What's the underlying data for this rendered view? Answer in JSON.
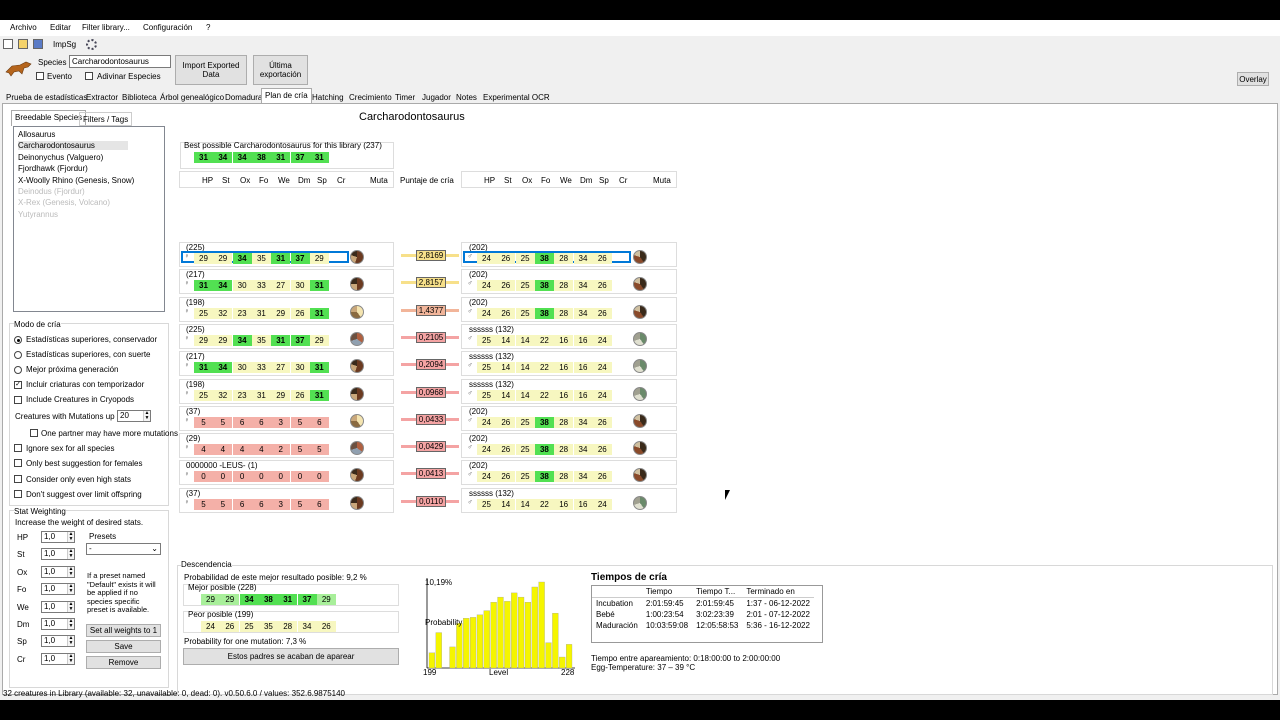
{
  "menu": [
    "Archivo",
    "Editar",
    "Filter library...",
    "Configuración",
    "?"
  ],
  "toolbar": {
    "impsg": "ImpSg"
  },
  "species": {
    "label": "Species",
    "value": "Carcharodontosaurus",
    "evento": "Evento",
    "adivinar": "Adivinar Especies"
  },
  "buttons": {
    "import": "Import Exported Data",
    "ultima": "Última exportación",
    "overlay": "Overlay"
  },
  "tabs": [
    "Prueba de estadísticas",
    "Extractor",
    "Biblioteca",
    "Árbol genealógico",
    "Domadura",
    "Plan de cría",
    "Hatching",
    "Crecimiento",
    "Timer",
    "Jugador",
    "Notes",
    "Experimental OCR"
  ],
  "left": {
    "tab_breedable": "Breedable Species",
    "tab_filters": "Filters / Tags",
    "species_list": [
      {
        "name": "Allosaurus",
        "enabled": true
      },
      {
        "name": "Carcharodontosaurus",
        "enabled": true
      },
      {
        "name": "Deinonychus (Valguero)",
        "enabled": true
      },
      {
        "name": "Fjordhawk (Fjordur)",
        "enabled": true
      },
      {
        "name": "X-Woolly Rhino (Genesis, Snow)",
        "enabled": true
      },
      {
        "name": "Deinodus (Fjordur)",
        "enabled": false
      },
      {
        "name": "X-Rex (Genesis, Volcano)",
        "enabled": false
      },
      {
        "name": "Yutyrannus",
        "enabled": false
      }
    ],
    "mode_title": "Modo de cría",
    "modes": [
      "Estadísticas superiores, conservador",
      "Estadísticas superiores, con suerte",
      "Mejor próxima generación"
    ],
    "opt_timer": "Incluir criaturas con temporizador",
    "opt_cryo": "Include Creatures in Cryopods",
    "mut_label": "Creatures with Mutations up to",
    "mut_value": "20",
    "one_partner": "One partner may have more mutations",
    "ignore_sex": "Ignore sex for all species",
    "only_best_f": "Only best suggestion for females",
    "even_high": "Consider only even high stats",
    "dont_suggest": "Don't suggest over limit offspring",
    "weight_title": "Stat Weighting",
    "weight_desc": "Increase the weight of desired stats.",
    "weights": [
      {
        "stat": "HP",
        "value": "1,0"
      },
      {
        "stat": "St",
        "value": "1,0"
      },
      {
        "stat": "Ox",
        "value": "1,0"
      },
      {
        "stat": "Fo",
        "value": "1,0"
      },
      {
        "stat": "We",
        "value": "1,0"
      },
      {
        "stat": "Dm",
        "value": "1,0"
      },
      {
        "stat": "Sp",
        "value": "1,0"
      },
      {
        "stat": "Cr",
        "value": "1,0"
      }
    ],
    "presets_label": "Presets",
    "presets_value": "-",
    "preset_note": "If a preset named \"Default\" exists it will be applied if no species specific preset is available.",
    "set_all": "Set all weights to 1",
    "save": "Save",
    "remove": "Remove"
  },
  "main": {
    "title": "Carcharodontosaurus",
    "best_label": "Best possible Carcharodontosaurus for this library (237)",
    "best_values": [
      "31",
      "34",
      "34",
      "38",
      "31",
      "37",
      "31"
    ],
    "stat_headers": [
      "HP",
      "St",
      "Ox",
      "Fo",
      "We",
      "Dm",
      "Sp",
      "Cr",
      "Muta"
    ],
    "score_header": "Puntaje de cría",
    "pairs": [
      {
        "lname": "(225)",
        "lsex": "♀",
        "lv": [
          "29",
          "29",
          "34",
          "35",
          "31",
          "37",
          "29"
        ],
        "lc": [
          "y",
          "y",
          "g",
          "y",
          "g",
          "g",
          "y"
        ],
        "score": "2,8169",
        "sc": "#f7e08a",
        "rname": "(202)",
        "rsex": "♂",
        "rv": [
          "24",
          "26",
          "25",
          "38",
          "28",
          "34",
          "26"
        ],
        "rc": [
          "y",
          "y",
          "y",
          "g",
          "y",
          "y",
          "y"
        ],
        "sel": true
      },
      {
        "lname": "(217)",
        "lsex": "♀",
        "lv": [
          "31",
          "34",
          "30",
          "33",
          "27",
          "30",
          "31"
        ],
        "lc": [
          "g",
          "g",
          "y",
          "y",
          "y",
          "y",
          "g"
        ],
        "score": "2,8157",
        "sc": "#f7e08a",
        "rname": "(202)",
        "rsex": "♂",
        "rv": [
          "24",
          "26",
          "25",
          "38",
          "28",
          "34",
          "26"
        ],
        "rc": [
          "y",
          "y",
          "y",
          "g",
          "y",
          "y",
          "y"
        ]
      },
      {
        "lname": "(198)",
        "lsex": "♀",
        "lv": [
          "25",
          "32",
          "23",
          "31",
          "29",
          "26",
          "31"
        ],
        "lc": [
          "y",
          "y",
          "y",
          "y",
          "y",
          "y",
          "g"
        ],
        "score": "1,4377",
        "sc": "#f2b59a",
        "rname": "(202)",
        "rsex": "♂",
        "rv": [
          "24",
          "26",
          "25",
          "38",
          "28",
          "34",
          "26"
        ],
        "rc": [
          "y",
          "y",
          "y",
          "g",
          "y",
          "y",
          "y"
        ]
      },
      {
        "lname": "(225)",
        "lsex": "♀",
        "lv": [
          "29",
          "29",
          "34",
          "35",
          "31",
          "37",
          "29"
        ],
        "lc": [
          "y",
          "y",
          "g",
          "y",
          "g",
          "g",
          "y"
        ],
        "score": "0,2105",
        "sc": "#f4a3a3",
        "rname": "ssssss (132)",
        "rsex": "♂",
        "rv": [
          "25",
          "14",
          "14",
          "22",
          "16",
          "16",
          "24"
        ],
        "rc": [
          "y",
          "y",
          "y",
          "y",
          "y",
          "y",
          "y"
        ]
      },
      {
        "lname": "(217)",
        "lsex": "♀",
        "lv": [
          "31",
          "34",
          "30",
          "33",
          "27",
          "30",
          "31"
        ],
        "lc": [
          "g",
          "g",
          "y",
          "y",
          "y",
          "y",
          "g"
        ],
        "score": "0,2094",
        "sc": "#f4a3a3",
        "rname": "ssssss (132)",
        "rsex": "♂",
        "rv": [
          "25",
          "14",
          "14",
          "22",
          "16",
          "16",
          "24"
        ],
        "rc": [
          "y",
          "y",
          "y",
          "y",
          "y",
          "y",
          "y"
        ]
      },
      {
        "lname": "(198)",
        "lsex": "♀",
        "lv": [
          "25",
          "32",
          "23",
          "31",
          "29",
          "26",
          "31"
        ],
        "lc": [
          "y",
          "y",
          "y",
          "y",
          "y",
          "y",
          "g"
        ],
        "score": "0,0968",
        "sc": "#f4a3a3",
        "rname": "ssssss (132)",
        "rsex": "♂",
        "rv": [
          "25",
          "14",
          "14",
          "22",
          "16",
          "16",
          "24"
        ],
        "rc": [
          "y",
          "y",
          "y",
          "y",
          "y",
          "y",
          "y"
        ]
      },
      {
        "lname": "(37)",
        "lsex": "♀",
        "lv": [
          "5",
          "5",
          "6",
          "6",
          "3",
          "5",
          "6"
        ],
        "lc": [
          "r",
          "r",
          "r",
          "r",
          "r",
          "r",
          "r"
        ],
        "score": "0,0433",
        "sc": "#f4a3a3",
        "rname": "(202)",
        "rsex": "♂",
        "rv": [
          "24",
          "26",
          "25",
          "38",
          "28",
          "34",
          "26"
        ],
        "rc": [
          "y",
          "y",
          "y",
          "g",
          "y",
          "y",
          "y"
        ]
      },
      {
        "lname": "(29)",
        "lsex": "♀",
        "lv": [
          "4",
          "4",
          "4",
          "4",
          "2",
          "5",
          "5"
        ],
        "lc": [
          "r",
          "r",
          "r",
          "r",
          "r",
          "r",
          "r"
        ],
        "score": "0,0429",
        "sc": "#f4a3a3",
        "rname": "(202)",
        "rsex": "♂",
        "rv": [
          "24",
          "26",
          "25",
          "38",
          "28",
          "34",
          "26"
        ],
        "rc": [
          "y",
          "y",
          "y",
          "g",
          "y",
          "y",
          "y"
        ]
      },
      {
        "lname": "0000000 -LEUS- (1)",
        "lsex": "♀",
        "lv": [
          "0",
          "0",
          "0",
          "0",
          "0",
          "0",
          "0"
        ],
        "lc": [
          "r",
          "r",
          "r",
          "r",
          "r",
          "r",
          "r"
        ],
        "score": "0,0413",
        "sc": "#f4a3a3",
        "rname": "(202)",
        "rsex": "♂",
        "rv": [
          "24",
          "26",
          "25",
          "38",
          "28",
          "34",
          "26"
        ],
        "rc": [
          "y",
          "y",
          "y",
          "g",
          "y",
          "y",
          "y"
        ]
      },
      {
        "lname": "(37)",
        "lsex": "♀",
        "lv": [
          "5",
          "5",
          "6",
          "6",
          "3",
          "5",
          "6"
        ],
        "lc": [
          "r",
          "r",
          "r",
          "r",
          "r",
          "r",
          "r"
        ],
        "score": "0,0110",
        "sc": "#f4a3a3",
        "rname": "ssssss (132)",
        "rsex": "♂",
        "rv": [
          "25",
          "14",
          "14",
          "22",
          "16",
          "16",
          "24"
        ],
        "rc": [
          "y",
          "y",
          "y",
          "y",
          "y",
          "y",
          "y"
        ]
      }
    ]
  },
  "offspring": {
    "title": "Descendencia",
    "prob_text": "Probabilidad de este mejor resultado posible: 9,2 %",
    "best_label": "Mejor posible (228)",
    "best_values": [
      "29",
      "29",
      "34",
      "38",
      "31",
      "37",
      "29"
    ],
    "best_colors": [
      "y",
      "y",
      "g",
      "g",
      "g",
      "g",
      "y"
    ],
    "worst_label": "Peor posible (199)",
    "worst_values": [
      "24",
      "26",
      "25",
      "35",
      "28",
      "34",
      "26"
    ],
    "one_mut": "Probability for one mutation: 7,3 %",
    "parents_btn": "Estos padres se acaban de aparear"
  },
  "chart_data": {
    "type": "bar",
    "xmin_label": "199",
    "xmax_label": "228",
    "xlabel": "Level",
    "ylabel": "Probability",
    "ymax_label": "10,19%",
    "values": [
      1.8,
      4.2,
      0,
      2.5,
      5.3,
      5.9,
      6.0,
      6.3,
      6.8,
      7.8,
      8.4,
      7.9,
      8.9,
      8.4,
      7.8,
      9.6,
      10.19,
      3.0,
      6.5,
      1.3,
      2.8
    ],
    "color": "#f5f500"
  },
  "times": {
    "title": "Tiempos de cría",
    "headers": [
      "",
      "Tiempo",
      "Tiempo T...",
      "Terminado en"
    ],
    "rows": [
      [
        "Incubation",
        "2:01:59:45",
        "2:01:59:45",
        "1:37 - 06-12-2022"
      ],
      [
        "Bebé",
        "1:00:23:54",
        "3:02:23:39",
        "2:01 - 07-12-2022"
      ],
      [
        "Maduración",
        "10:03:59:08",
        "12:05:58:53",
        "5:36 - 16-12-2022"
      ]
    ],
    "mating": "Tiempo entre apareamiento: 0:18:00:00 to 2:00:00:00",
    "egg": "Egg-Temperature: 37 – 39 °C"
  },
  "status": "32 creatures in Library (available: 32, unavailable: 0, dead: 0). v0.50.6.0 / values: 352.6.9875140",
  "colors": {
    "green": "#52e052",
    "lightgreen": "#a8ef9a",
    "yellow": "#f7f7c0",
    "red": "#f4b0a8",
    "selection": "#0078d7"
  }
}
